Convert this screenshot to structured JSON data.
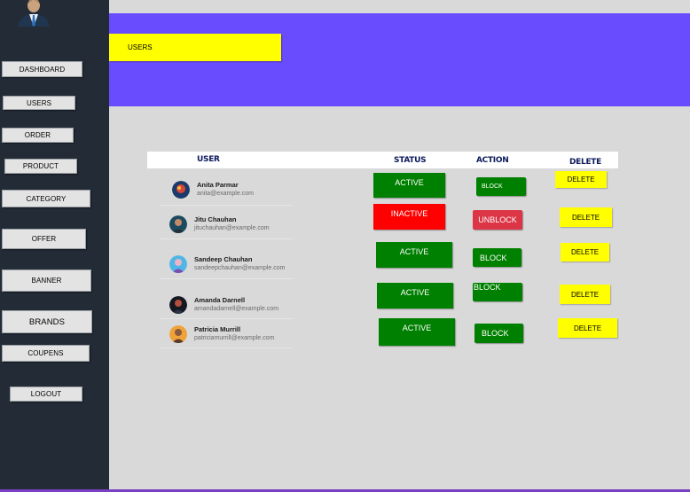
{
  "sidebar": {
    "items": [
      {
        "label": "DASHBOARD"
      },
      {
        "label": "USERS"
      },
      {
        "label": "ORDER"
      },
      {
        "label": "PRODUCT"
      },
      {
        "label": "CATEGORY"
      },
      {
        "label": "OFFER"
      },
      {
        "label": "BANNER"
      },
      {
        "label": "BRANDS"
      },
      {
        "label": "COUPENS"
      },
      {
        "label": "LOGOUT"
      }
    ]
  },
  "banner": {
    "title": "USERS"
  },
  "table": {
    "headers": {
      "user": "USER",
      "status": "STATUS",
      "action": "ACTION",
      "delete": "DELETE"
    },
    "rows": [
      {
        "name": "Anita Parmar",
        "email": "anita@example.com",
        "status": "ACTIVE",
        "action": "BLOCK",
        "delete": "DELETE"
      },
      {
        "name": "Jitu Chauhan",
        "email": "jituchauhan@example.com",
        "status": "INACTIVE",
        "action": "UNBLOCK",
        "delete": "DELETE"
      },
      {
        "name": "Sandeep Chauhan",
        "email": "sandeepchauhan@example.com",
        "status": "ACTIVE",
        "action": "BLOCK",
        "delete": "DELETE"
      },
      {
        "name": "Amanda Darnell",
        "email": "amandadarnell@example.com",
        "status": "ACTIVE",
        "action": "BLOCK",
        "delete": "DELETE"
      },
      {
        "name": "Patricia Murrill",
        "email": "patriciamurrill@example.com",
        "status": "ACTIVE",
        "action": "BLOCK",
        "delete": "DELETE"
      }
    ]
  },
  "colors": {
    "sidebar_bg": "#232b36",
    "banner_bg": "#6a4cff",
    "highlight_yellow": "#ffff00",
    "active_green": "#008000",
    "inactive_red": "#ff0000",
    "unblock_red": "#dc3545",
    "header_text": "#0d1a5c"
  },
  "icons": {
    "admin_avatar": "user-avatar-icon"
  }
}
